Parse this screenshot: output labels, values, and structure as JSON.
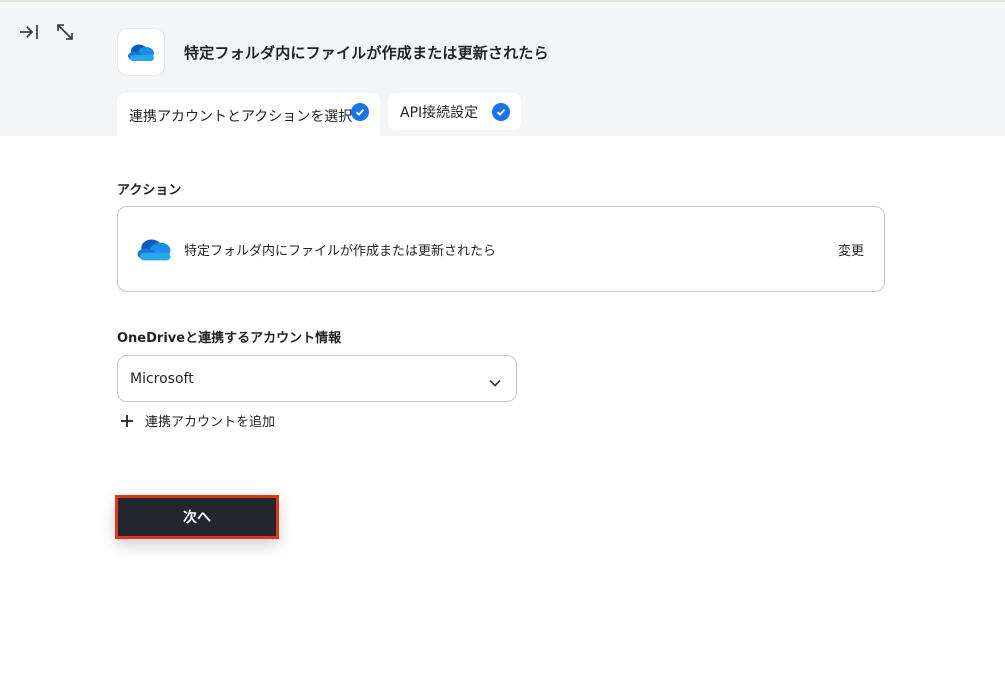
{
  "header": {
    "title": "特定フォルダ内にファイルが作成または更新されたら",
    "tabs": [
      {
        "label": "連携アカウントとアクションを選択",
        "completed": true
      },
      {
        "label": "API接続設定",
        "completed": true
      }
    ]
  },
  "action_section": {
    "label": "アクション",
    "action_text": "特定フォルダ内にファイルが作成または更新されたら",
    "change_label": "変更"
  },
  "account_section": {
    "label": "OneDriveと連携するアカウント情報",
    "selected_account": "Microsoft",
    "add_account_label": "連携アカウントを追加"
  },
  "next_button_label": "次へ",
  "colors": {
    "header_bg": "#f4f5f7",
    "check_blue": "#1a73e8",
    "button_dark": "#23262d",
    "highlight_red": "#e0361c",
    "onedrive_blue": "#0a64c8"
  }
}
